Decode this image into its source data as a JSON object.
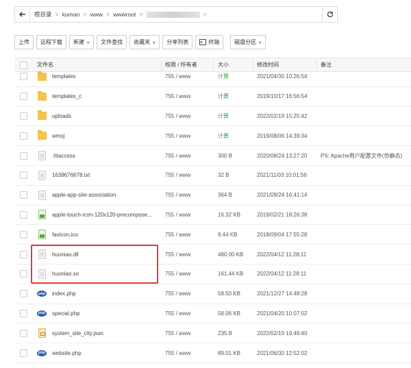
{
  "pathbar": {
    "crumbs": [
      "根目录",
      "kuman",
      "www",
      "wwwroot"
    ]
  },
  "toolbar": {
    "buttons": [
      {
        "label": "上传",
        "dropdown": false
      },
      {
        "label": "远程下载",
        "dropdown": false
      },
      {
        "label": "新建",
        "dropdown": true
      },
      {
        "label": "文件查找",
        "dropdown": false
      },
      {
        "label": "收藏夹",
        "dropdown": true
      },
      {
        "label": "分享列表",
        "dropdown": false
      },
      {
        "label": "终端",
        "dropdown": false
      },
      {
        "label": "磁盘分区",
        "dropdown": true
      }
    ]
  },
  "table": {
    "headers": {
      "name": "文件名",
      "perm": "权限 / 所有者",
      "size": "大小",
      "time": "修改时间",
      "note": "备注"
    },
    "rows": [
      {
        "icon": "folder",
        "name": "templates",
        "perm": "755 / www",
        "size": "计算",
        "time": "2021/04/30 10:26:54",
        "note": ""
      },
      {
        "icon": "folder",
        "name": "templates_c",
        "perm": "755 / www",
        "size": "计算",
        "time": "2019/10/17 16:56:54",
        "note": ""
      },
      {
        "icon": "folder",
        "name": "uploads",
        "perm": "755 / www",
        "size": "计算",
        "time": "2022/02/19 15:25:42",
        "note": ""
      },
      {
        "icon": "folder",
        "name": "wmsj",
        "perm": "755 / www",
        "size": "计算",
        "time": "2019/08/06 14:39:34",
        "note": ""
      },
      {
        "icon": "doc",
        "name": ".htaccess",
        "perm": "755 / www",
        "size": "300 B",
        "time": "2020/08/24 13:27:20",
        "note": "PS: Apache用户配置文件(伪静态)"
      },
      {
        "icon": "doc",
        "name": "1638676678.txt",
        "perm": "755 / www",
        "size": "32 B",
        "time": "2021/11/03 10:01:56",
        "note": ""
      },
      {
        "icon": "doc",
        "name": "apple-app-site-association",
        "perm": "755 / www",
        "size": "364 B",
        "time": "2021/09/24 16:41:14",
        "note": ""
      },
      {
        "icon": "image",
        "name": "apple-touch-icon-120x120-precompose...",
        "perm": "755 / www",
        "size": "16.32 KB",
        "time": "2019/02/21 18:26:38",
        "note": ""
      },
      {
        "icon": "image",
        "name": "favicon.ico",
        "perm": "755 / www",
        "size": "9.44 KB",
        "time": "2018/09/04 17:55:28",
        "note": ""
      },
      {
        "icon": "doc",
        "name": "huoniao.dll",
        "perm": "755 / www",
        "size": "480.00 KB",
        "time": "2022/04/12 11:28:11",
        "note": ""
      },
      {
        "icon": "doc",
        "name": "huoniao.so",
        "perm": "755 / www",
        "size": "161.44 KB",
        "time": "2022/04/12 11:28:11",
        "note": ""
      },
      {
        "icon": "php",
        "name": "index.php",
        "perm": "755 / www",
        "size": "58.50 KB",
        "time": "2021/12/27 14:48:28",
        "note": ""
      },
      {
        "icon": "php",
        "name": "special.php",
        "perm": "755 / www",
        "size": "58.06 KB",
        "time": "2021/04/20 10:07:02",
        "note": ""
      },
      {
        "icon": "json",
        "name": "system_site_city.json",
        "perm": "755 / www",
        "size": "235 B",
        "time": "2022/02/19 19:49:40",
        "note": ""
      },
      {
        "icon": "php",
        "name": "website.php",
        "perm": "755 / www",
        "size": "89.01 KB",
        "time": "2021/06/30 12:52:02",
        "note": ""
      }
    ]
  },
  "colors": {
    "calc": "#20a53a",
    "highlight": "#e53935"
  },
  "icons": {
    "back": "arrow-left-icon",
    "refresh": "refresh-icon",
    "php_label": "php"
  }
}
